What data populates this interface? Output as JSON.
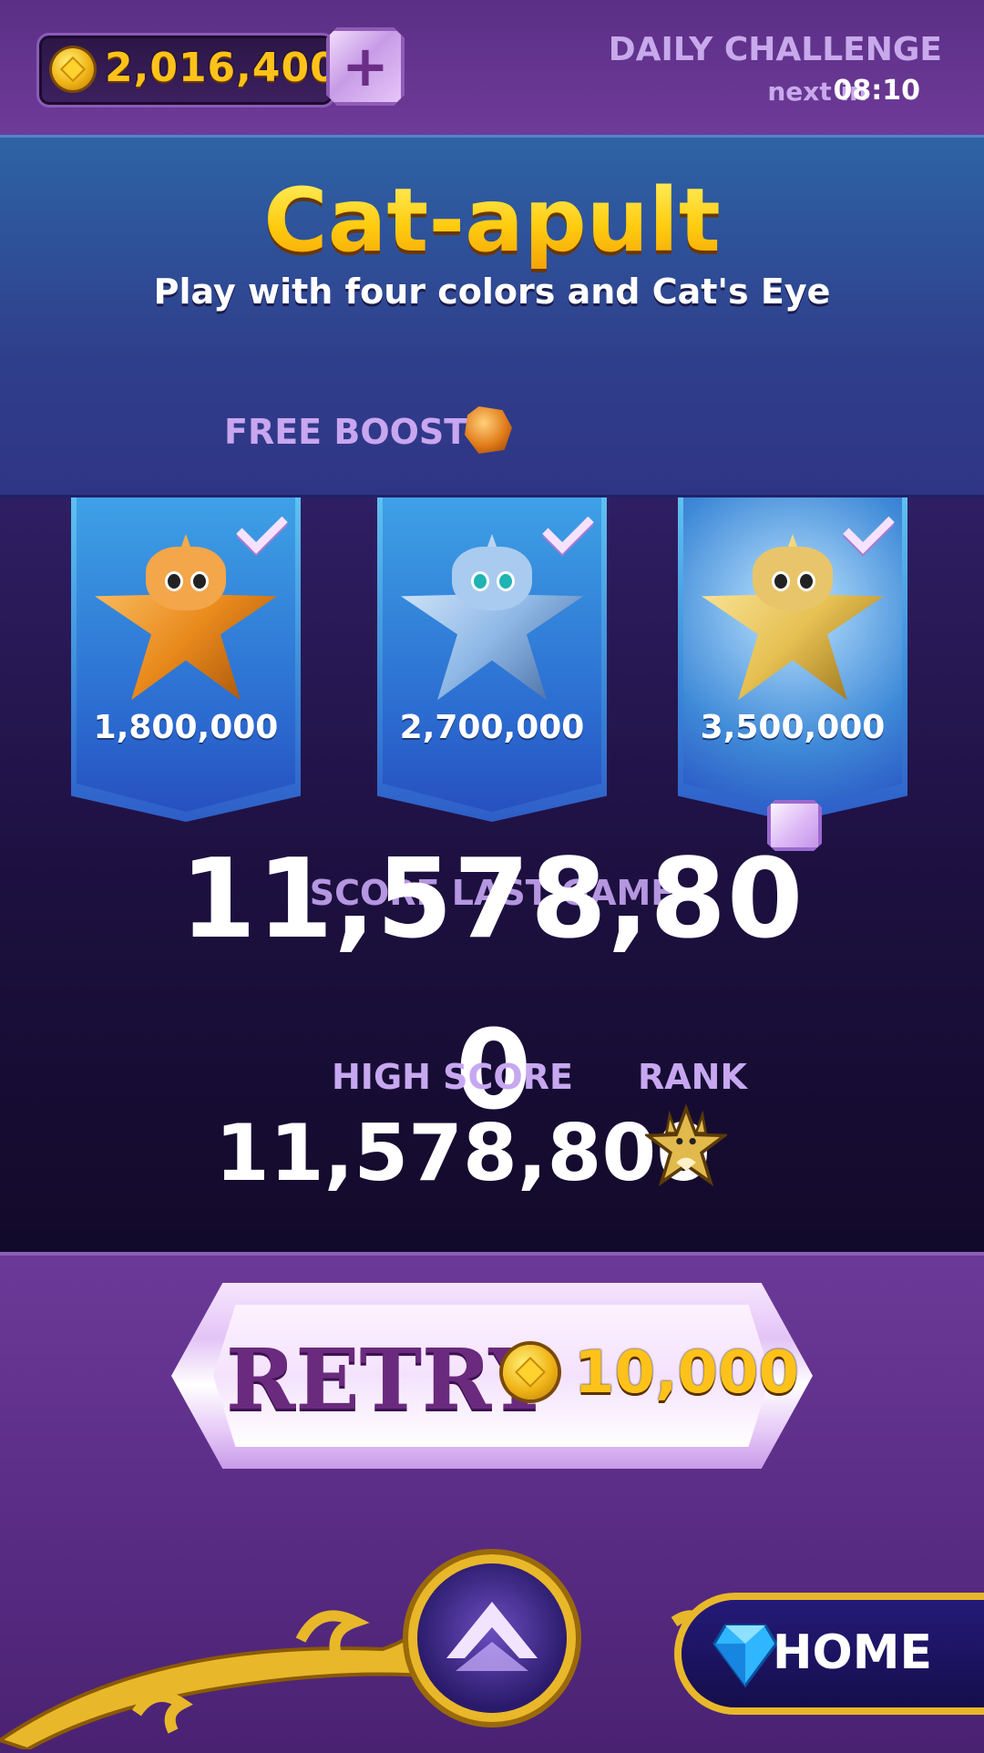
{
  "header": {
    "coins": "2,016,400",
    "daily_title": "DAILY CHALLENGE",
    "next_label": "next in",
    "timer": "08:10"
  },
  "challenge": {
    "title": "Cat-apult",
    "subtitle": "Play with four colors and Cat's Eye",
    "free_boosts_label": "FREE BOOSTS"
  },
  "tiers": [
    {
      "value": "1,800,000",
      "color": "#f0a232"
    },
    {
      "value": "2,700,000",
      "color": "#8fc0e8"
    },
    {
      "value": "3,500,000",
      "color": "#e9c15a"
    }
  ],
  "scores": {
    "last_game_label": "SCORE LAST GAME",
    "last_game_value": "11,578,80",
    "last_game_wrap": "0",
    "high_score_label": "HIGH SCORE",
    "high_score_value": "11,578,800",
    "rank_label": "RANK"
  },
  "actions": {
    "retry_label": "RETRY",
    "retry_cost": "10,000",
    "home_label": "HOME"
  }
}
